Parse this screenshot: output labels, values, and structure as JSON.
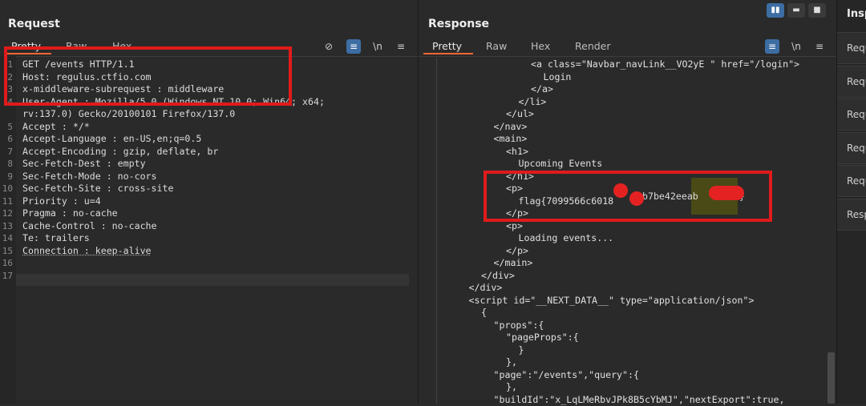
{
  "request": {
    "title": "Request",
    "tabs": [
      "Pretty",
      "Raw",
      "Hex"
    ],
    "tools": {
      "eye_off": "⊘",
      "wrap": "≡",
      "newline": "\\n",
      "menu": "≡"
    },
    "lines": [
      {
        "n": "1",
        "t": "GET /events HTTP/1.1"
      },
      {
        "n": "2",
        "t": "Host: regulus.ctfio.com"
      },
      {
        "n": "3",
        "t": "x-middleware-subrequest : middleware"
      },
      {
        "n": "4",
        "t": "User-Agent : Mozilla/5.0 (Windows NT 10.0; Win64; x64;"
      },
      {
        "n": "",
        "t": "rv:137.0) Gecko/20100101 Firefox/137.0"
      },
      {
        "n": "5",
        "t": "Accept : */*"
      },
      {
        "n": "6",
        "t": "Accept-Language : en-US,en;q=0.5"
      },
      {
        "n": "7",
        "t": "Accept-Encoding : gzip, deflate, br"
      },
      {
        "n": "8",
        "t": "Sec-Fetch-Dest : empty"
      },
      {
        "n": "9",
        "t": "Sec-Fetch-Mode : no-cors"
      },
      {
        "n": "10",
        "t": "Sec-Fetch-Site : cross-site"
      },
      {
        "n": "11",
        "t": "Priority : u=4"
      },
      {
        "n": "12",
        "t": "Pragma : no-cache"
      },
      {
        "n": "13",
        "t": "Cache-Control : no-cache"
      },
      {
        "n": "14",
        "t": "Te: trailers"
      },
      {
        "n": "15",
        "t": "Connection : keep-alive"
      },
      {
        "n": "16",
        "t": ""
      },
      {
        "n": "17",
        "t": ""
      }
    ]
  },
  "response": {
    "title": "Response",
    "tabs": [
      "Pretty",
      "Raw",
      "Hex",
      "Render"
    ],
    "tools": {
      "wrap": "≡",
      "newline": "\\n",
      "menu": "≡"
    },
    "lines": [
      {
        "indent": 0,
        "t": "<a class=\"Navbar_navLink__VO2yE \" href=\"/login\">"
      },
      {
        "indent": 1,
        "t": "Login"
      },
      {
        "indent": 0,
        "t": "</a>"
      },
      {
        "indent": -1,
        "t": "</li>"
      },
      {
        "indent": -2,
        "t": "</ul>"
      },
      {
        "indent": -3,
        "t": "</nav>"
      },
      {
        "indent": -3,
        "t": "<main>"
      },
      {
        "indent": -2,
        "t": "<h1>"
      },
      {
        "indent": -1,
        "t": "Upcoming Events"
      },
      {
        "indent": -2,
        "t": "</h1>"
      },
      {
        "indent": -2,
        "t": "<p>"
      },
      {
        "indent": -1,
        "t": "flag{7099566c6018"
      },
      {
        "indent": -2,
        "t": "</p>"
      },
      {
        "indent": -2,
        "t": "<p>"
      },
      {
        "indent": -1,
        "t": "Loading events..."
      },
      {
        "indent": -2,
        "t": "</p>"
      },
      {
        "indent": -3,
        "t": "</main>"
      },
      {
        "indent": -4,
        "t": "</div>"
      },
      {
        "indent": -5,
        "t": "</div>"
      },
      {
        "indent": -5,
        "t": "<script id=\"__NEXT_DATA__\" type=\"application/json\">"
      },
      {
        "indent": -4,
        "t": "{"
      },
      {
        "indent": -3,
        "t": "\"props\":{"
      },
      {
        "indent": -2,
        "t": "\"pageProps\":{"
      },
      {
        "indent": -1,
        "t": "}"
      },
      {
        "indent": -2,
        "t": "},"
      },
      {
        "indent": -3,
        "t": "\"page\":\"/events\",\"query\":{"
      },
      {
        "indent": -2,
        "t": "},"
      },
      {
        "indent": -3,
        "t": "\"buildId\":\"x_LqLMeRbvJPk8B5cYbMJ\",\"nextExport\":true,"
      }
    ],
    "flag_tail": "bb7be42eeab",
    "flag_end": "}"
  },
  "view_buttons": [
    "▮▮",
    "▬",
    "■"
  ],
  "inspector": {
    "title": "Insp",
    "items": [
      "Requ",
      "Requ",
      "Requ",
      "Requ",
      "Requ",
      "Resp"
    ]
  },
  "colors": {
    "highlight_box": "#e01b1b",
    "accent_tab": "#ff6633",
    "toggle_on": "#3d6ea3"
  }
}
